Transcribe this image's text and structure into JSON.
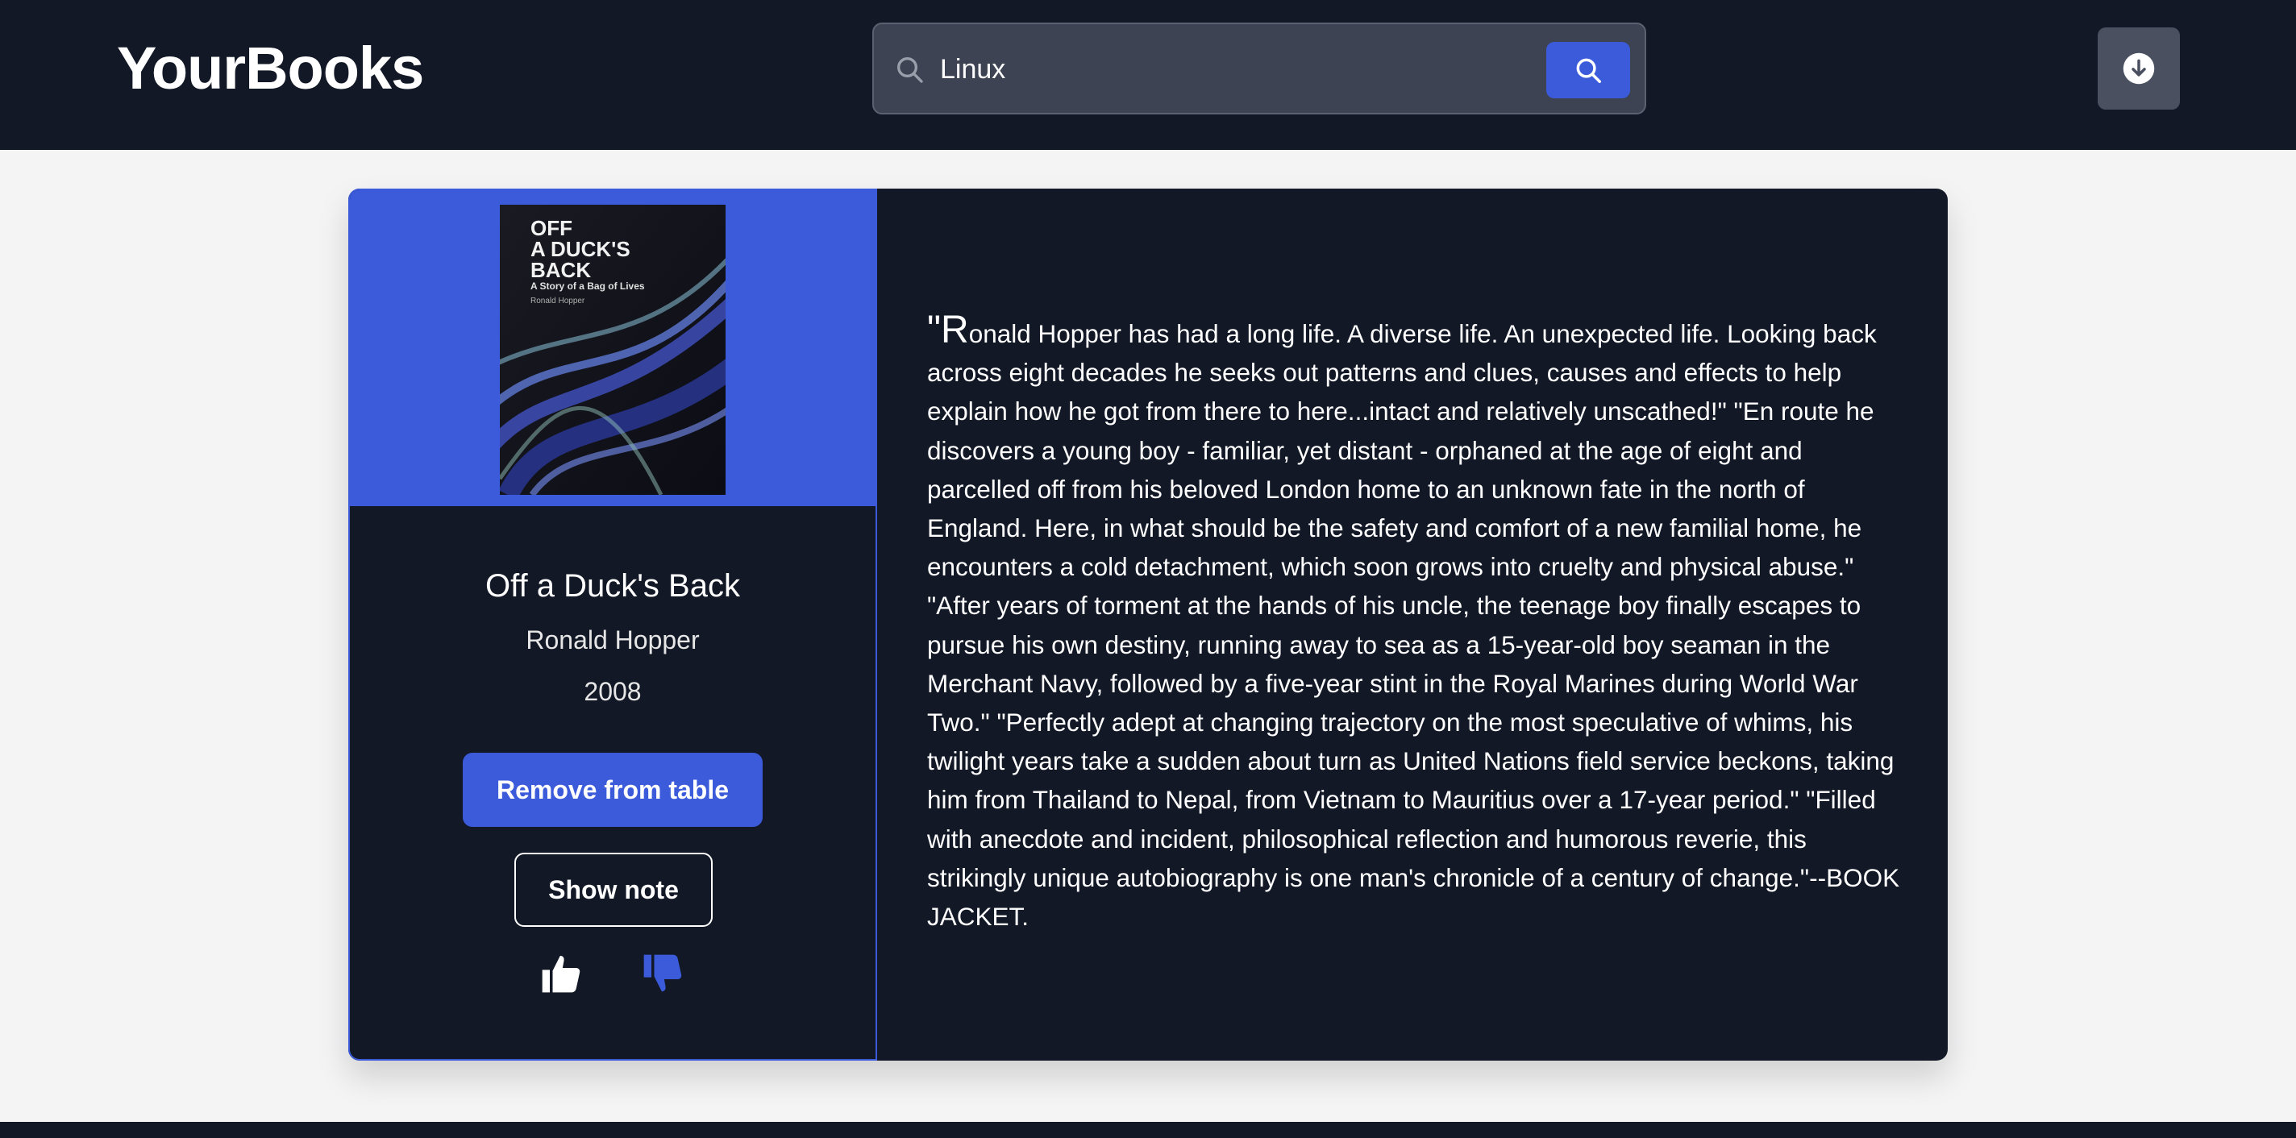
{
  "header": {
    "logo": "YourBooks",
    "search": {
      "value": "Linux",
      "placeholder": ""
    },
    "icons": {
      "search": "search-icon",
      "download": "download-icon"
    }
  },
  "book": {
    "cover": {
      "title_line1": "OFF",
      "title_line2": "A DUCK'S",
      "title_line3": "BACK",
      "subtitle": "A Story of a Bag of Lives",
      "author": "Ronald Hopper"
    },
    "title": "Off a Duck's Back",
    "author": "Ronald Hopper",
    "year": "2008",
    "actions": {
      "remove_label": "Remove from table",
      "note_label": "Show note"
    },
    "reactions": {
      "like_icon": "thumbs-up-icon",
      "dislike_icon": "thumbs-down-icon"
    },
    "description_first": "\"R",
    "description_rest": "onald Hopper has had a long life. A diverse life. An unexpected life. Looking back across eight decades he seeks out patterns and clues, causes and effects to help explain how he got from there to here...intact and relatively unscathed!\" \"En route he discovers a young boy - familiar, yet distant - orphaned at the age of eight and parcelled off from his beloved London home to an unknown fate in the north of England. Here, in what should be the safety and comfort of a new familial home, he encounters a cold detachment, which soon grows into cruelty and physical abuse.\" \"After years of torment at the hands of his uncle, the teenage boy finally escapes to pursue his own destiny, running away to sea as a 15-year-old boy seaman in the Merchant Navy, followed by a five-year stint in the Royal Marines during World War Two.\" \"Perfectly adept at changing trajectory on the most speculative of whims, his twilight years take a sudden about turn as United Nations field service beckons, taking him from Thailand to Nepal, from Vietnam to Mauritius over a 17-year period.\" \"Filled with anecdote and incident, philosophical reflection and humorous reverie, this strikingly unique autobiography is one man's chronicle of a century of change.\"--BOOK JACKET."
  },
  "colors": {
    "header_bg": "#121826",
    "accent": "#3b5bdb",
    "card_bg": "#121826",
    "page_bg": "#f4f4f5"
  }
}
